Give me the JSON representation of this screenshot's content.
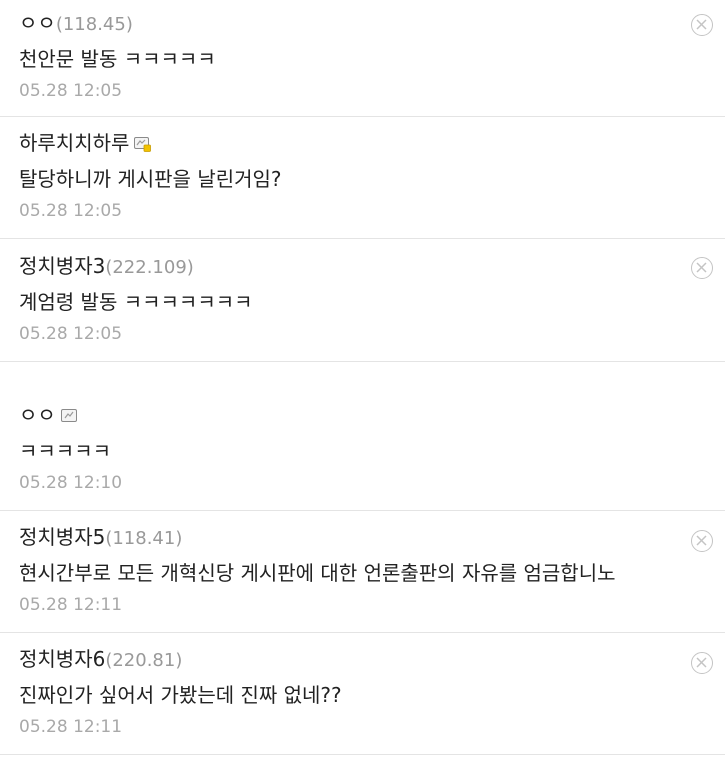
{
  "comments": [
    {
      "nick": "ㅇㅇ",
      "ip": "(118.45)",
      "content": "천안문 발동 ㅋㅋㅋㅋㅋ",
      "date": "05.28 12:05",
      "deletable": true
    },
    {
      "nick": "하루치치하루",
      "ip": "",
      "member_icon": "fixed-member-icon",
      "content": "탈당하니까 게시판을 날린거임?",
      "date": "05.28 12:05",
      "deletable": false
    },
    {
      "nick": "정치병자3",
      "ip": "(222.109)",
      "content": "계엄령 발동 ㅋㅋㅋㅋㅋㅋㅋ",
      "date": "05.28 12:05",
      "deletable": true
    },
    {
      "nick": "ㅇㅇ",
      "ip": "",
      "member_icon": "half-member-icon",
      "content": "ㅋㅋㅋㅋㅋ",
      "date": "05.28 12:10",
      "deletable": false
    },
    {
      "nick": "정치병자5",
      "ip": "(118.41)",
      "content": "현시간부로 모든 개혁신당 게시판에 대한 언론출판의 자유를 엄금합니노",
      "date": "05.28 12:11",
      "deletable": true
    },
    {
      "nick": "정치병자6",
      "ip": "(220.81)",
      "content": "진짜인가 싶어서 가봤는데 진짜 없네??",
      "date": "05.28 12:11",
      "deletable": true
    }
  ],
  "colors": {
    "text": "#222222",
    "ip": "#999999",
    "date": "#a9a9a9",
    "divider": "#e4e4e4",
    "delete_icon": "#c4c4c4"
  }
}
